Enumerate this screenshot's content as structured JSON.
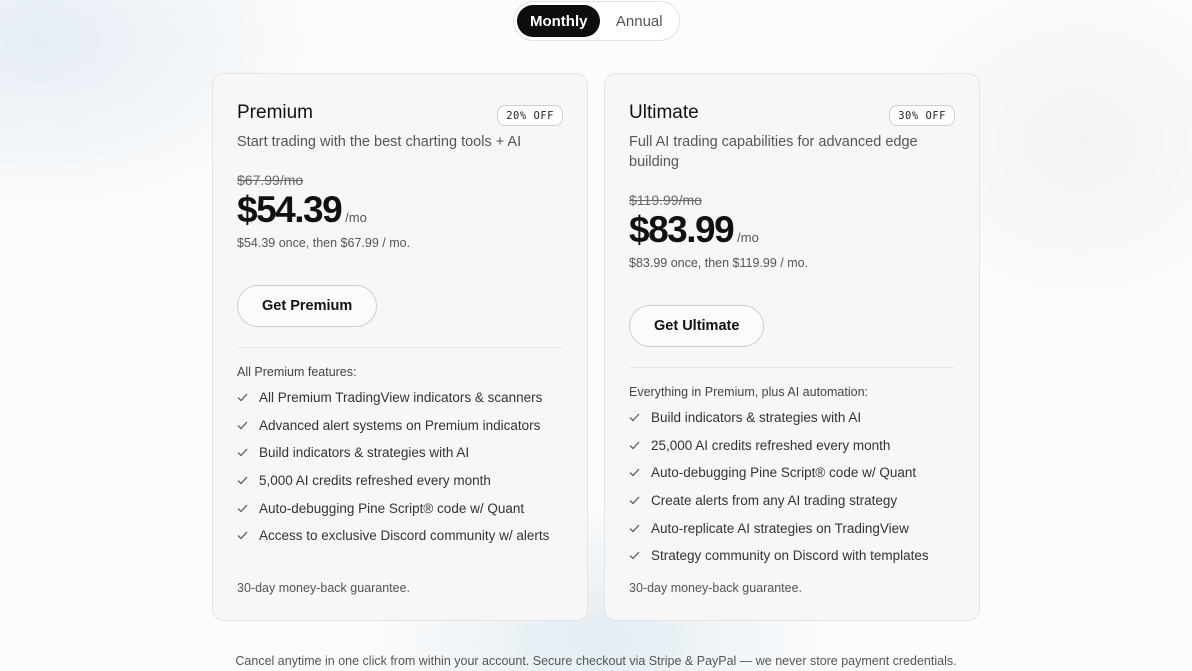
{
  "billing_toggle": {
    "monthly_label": "Monthly",
    "annual_label": "Annual",
    "selected": "Monthly"
  },
  "plans": [
    {
      "name": "Premium",
      "discount_badge": "20% OFF",
      "description": "Start trading with the best charting tools + AI",
      "old_price": "$67.99/mo",
      "price": "$54.39",
      "per": "/mo",
      "price_note": "$54.39 once, then $67.99 / mo.",
      "cta": "Get Premium",
      "features_heading": "All Premium features:",
      "features": [
        "All Premium TradingView indicators & scanners",
        "Advanced alert systems on Premium indicators",
        "Build indicators & strategies with AI",
        "5,000 AI credits refreshed every month",
        "Auto-debugging Pine Script® code w/ Quant",
        "Access to exclusive Discord community w/ alerts"
      ],
      "guarantee": "30-day money-back guarantee."
    },
    {
      "name": "Ultimate",
      "discount_badge": "30% OFF",
      "description": "Full AI trading capabilities for advanced edge building",
      "old_price": "$119.99/mo",
      "price": "$83.99",
      "per": "/mo",
      "price_note": "$83.99 once, then $119.99 / mo.",
      "cta": "Get Ultimate",
      "features_heading": "Everything in Premium, plus AI automation:",
      "features": [
        "Build indicators & strategies with AI",
        "25,000 AI credits refreshed every month",
        "Auto-debugging Pine Script® code w/ Quant",
        "Create alerts from any AI trading strategy",
        "Auto-replicate AI strategies on TradingView",
        "Strategy community on Discord with templates"
      ],
      "guarantee": "30-day money-back guarantee."
    }
  ],
  "footer_note": "Cancel anytime in one click from within your account. Secure checkout via Stripe & PayPal — we never store payment credentials.",
  "icons": {
    "feature_check": "check-icon"
  },
  "colors": {
    "accent": "#0d0d0d",
    "card_bg": "#f7f7f7",
    "border": "#e3e3e3"
  }
}
